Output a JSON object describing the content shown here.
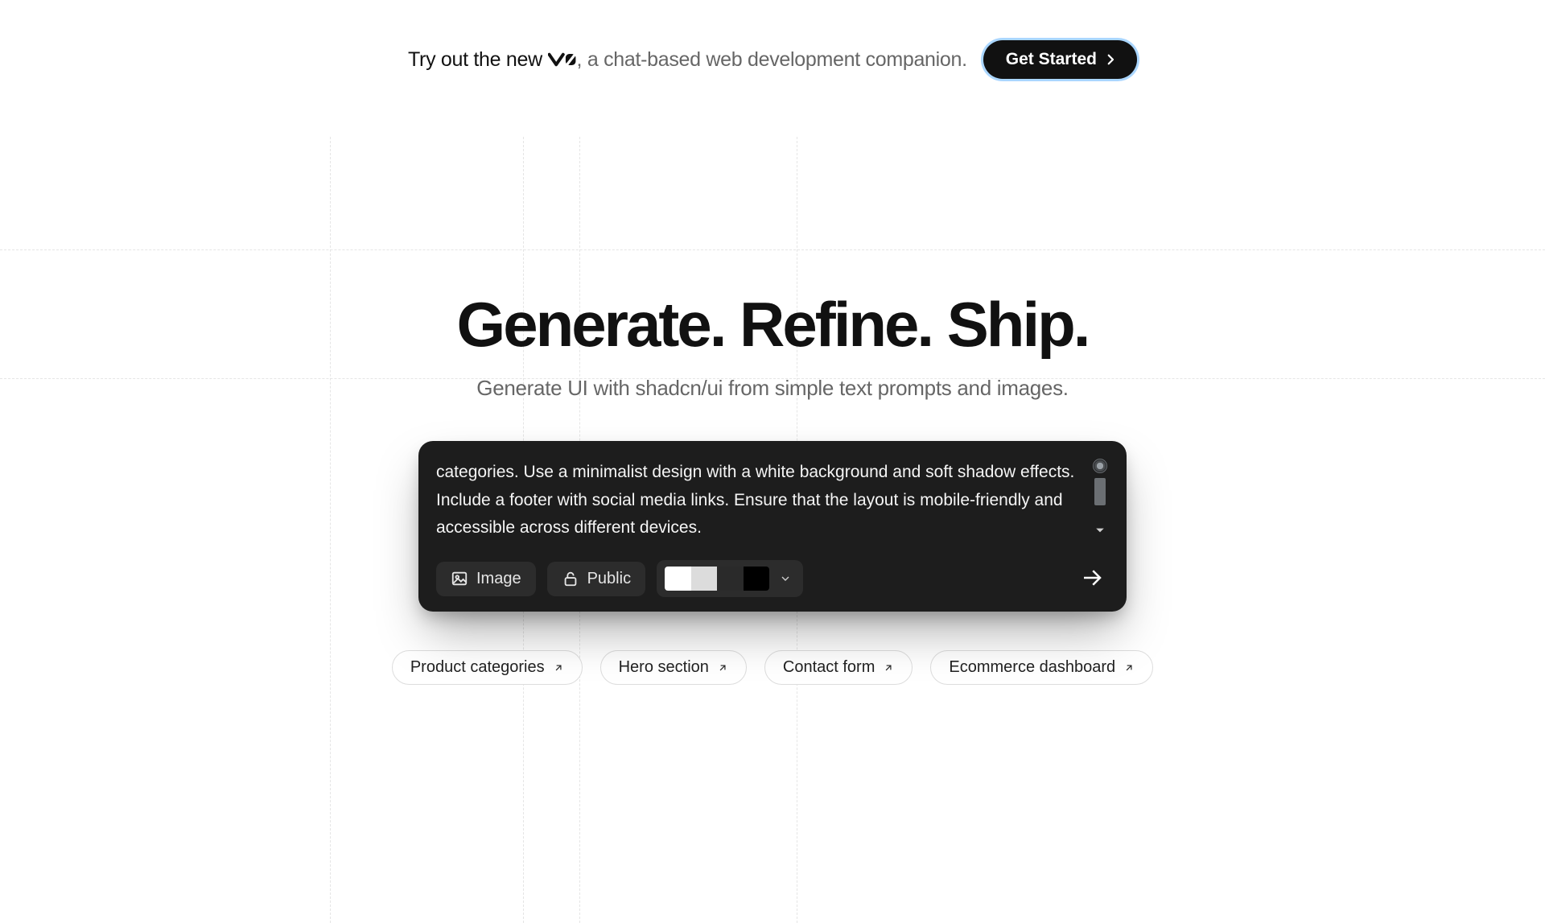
{
  "announce": {
    "prefix": "Try out the new ",
    "brand": "v0",
    "suffix": ", a chat-based web development companion.",
    "cta": "Get Started"
  },
  "hero": {
    "title": "Generate. Refine. Ship.",
    "subtitle": "Generate UI with shadcn/ui from simple text prompts and images."
  },
  "prompt": {
    "value": "categories. Use a minimalist design with a white background and soft shadow effects. Include a footer with social media links. Ensure that the layout is mobile-friendly and accessible across different devices."
  },
  "controls": {
    "image_label": "Image",
    "visibility_label": "Public",
    "theme_swatches": [
      "#ffffff",
      "#dcdcdc",
      "#2a2a2a",
      "#000000"
    ]
  },
  "suggestions": [
    "Product categories",
    "Hero section",
    "Contact form",
    "Ecommerce dashboard"
  ]
}
